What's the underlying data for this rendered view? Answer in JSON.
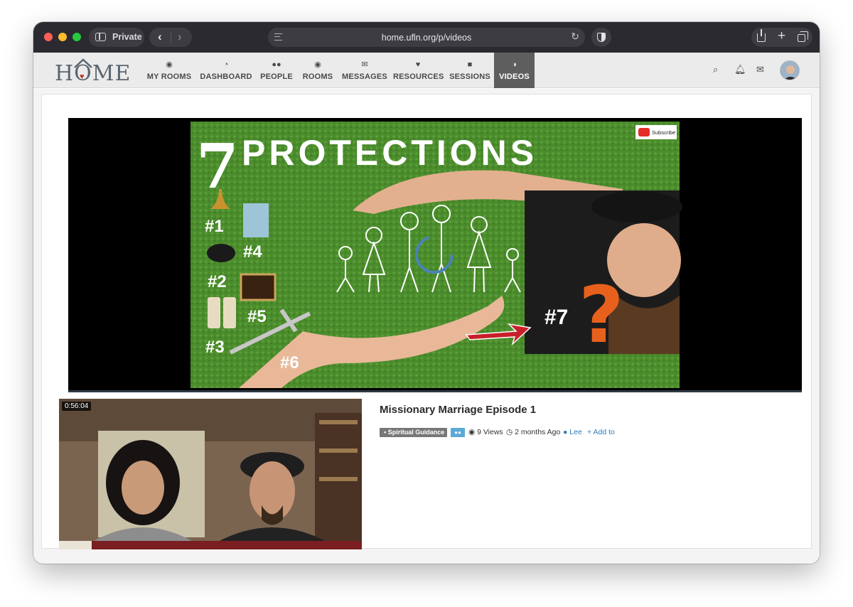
{
  "browser": {
    "private_label": "Private",
    "url": "home.ufln.org/p/videos"
  },
  "site": {
    "logo_text": "HOME",
    "nav": [
      {
        "label": "MY ROOMS",
        "icon": "target-icon"
      },
      {
        "label": "DASHBOARD",
        "icon": "gauge-icon"
      },
      {
        "label": "PEOPLE",
        "icon": "people-icon"
      },
      {
        "label": "ROOMS",
        "icon": "target-icon"
      },
      {
        "label": "MESSAGES",
        "icon": "envelope-icon"
      },
      {
        "label": "RESOURCES",
        "icon": "heart-icon"
      },
      {
        "label": "SESSIONS",
        "icon": "video-camera-icon"
      },
      {
        "label": "VIDEOS",
        "icon": "half-circle-icon",
        "active": true
      }
    ]
  },
  "player": {
    "headline_number": "7",
    "headline": "PROTECTIONS",
    "subscribe": "Subscribe",
    "markers": [
      "#1",
      "#2",
      "#3",
      "#4",
      "#5",
      "#6",
      "#7"
    ]
  },
  "video": {
    "title": "Missionary Marriage Episode 1",
    "category": "Spiritual Guidance",
    "views": "9 Views",
    "ago": "2 months Ago",
    "user": "Lee",
    "add_to": "Add to",
    "duration": "0:56:04"
  },
  "colors": {
    "active_nav": "#5e5e5e",
    "link": "#2f7bb7",
    "category_badge": "#777777",
    "group_badge": "#5aa9d6"
  }
}
